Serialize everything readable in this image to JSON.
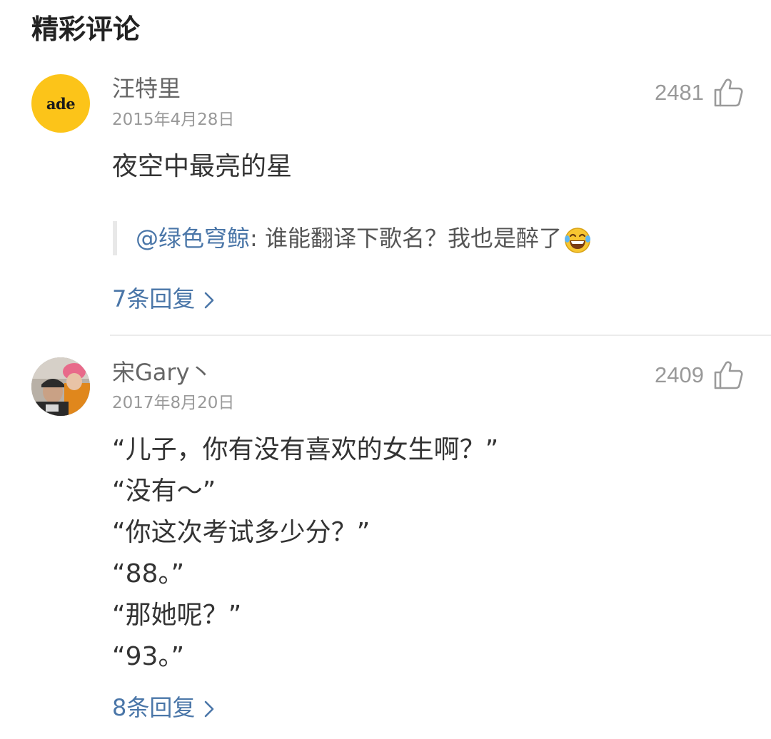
{
  "section_title": "精彩评论",
  "comments": [
    {
      "avatar_text": "ade",
      "username": "汪特里",
      "date": "2015年4月28日",
      "likes": "2481",
      "content_lines": [
        "夜空中最亮的星"
      ],
      "quote": {
        "mention": "@绿色穹鲸",
        "separator": ": ",
        "text": "谁能翻译下歌名？我也是醉了"
      },
      "replies_label": "7条回复"
    },
    {
      "username": "宋Gary丶",
      "date": "2017年8月20日",
      "likes": "2409",
      "content_lines": [
        "“儿子，你有没有喜欢的女生啊？”",
        "“没有～”",
        "“你这次考试多少分？”",
        "“88。”",
        "“那她呢？”",
        "“93。”"
      ],
      "replies_label": "8条回复"
    }
  ],
  "colors": {
    "link": "#4a76a8",
    "meta": "#999999",
    "avatar_yellow": "#fcc419"
  },
  "icons": {
    "like": "thumbs-up-icon",
    "chevron": "chevron-right-icon",
    "emoji": "laughing-tears-emoji"
  }
}
